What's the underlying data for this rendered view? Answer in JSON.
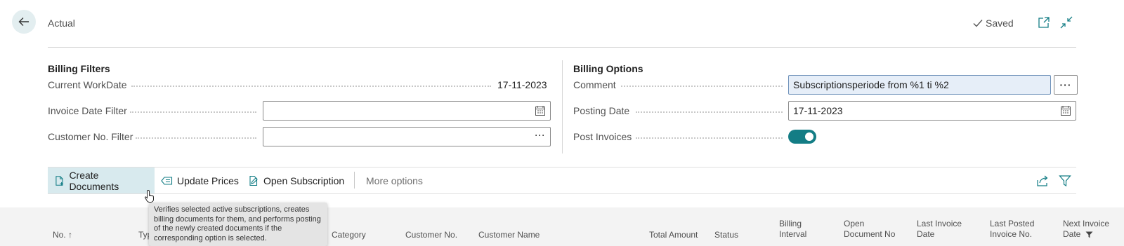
{
  "header": {
    "title": "Actual",
    "saved_label": "Saved"
  },
  "billing_filters": {
    "title": "Billing Filters",
    "current_workdate_label": "Current WorkDate",
    "current_workdate_value": "17-11-2023",
    "invoice_date_filter_label": "Invoice Date Filter",
    "invoice_date_filter_value": "",
    "customer_no_filter_label": "Customer No. Filter",
    "customer_no_filter_value": ""
  },
  "billing_options": {
    "title": "Billing Options",
    "comment_label": "Comment",
    "comment_value": "Subscriptionsperiode from %1 ti %2",
    "posting_date_label": "Posting Date",
    "posting_date_value": "17-11-2023",
    "post_invoices_label": "Post Invoices",
    "post_invoices_on": true
  },
  "actions": {
    "create_documents": "Create Documents",
    "update_prices": "Update Prices",
    "open_subscription": "Open Subscription",
    "more_options": "More options"
  },
  "tooltip": {
    "text": "Verifies selected active subscriptions, creates billing documents for them, and performs posting of the newly created documents if the corresponding option is selected."
  },
  "columns": {
    "no": "No. ↑",
    "type": "Typ",
    "category": "Category",
    "customer_no": "Customer No.",
    "customer_name": "Customer Name",
    "total_amount": "Total Amount",
    "status": "Status",
    "billing_interval_1": "Billing",
    "billing_interval_2": "Interval",
    "open_document_no_1": "Open",
    "open_document_no_2": "Document No",
    "last_invoice_date_1": "Last Invoice",
    "last_invoice_date_2": "Date",
    "last_posted_invoice_no_1": "Last Posted",
    "last_posted_invoice_no_2": "Invoice No.",
    "next_invoice_date_1": "Next Invoice",
    "next_invoice_date_2": "Date"
  },
  "colors": {
    "accent": "#137d85",
    "selected_action_bg": "#d8eaee",
    "back_button_bg": "#e3eef0"
  }
}
